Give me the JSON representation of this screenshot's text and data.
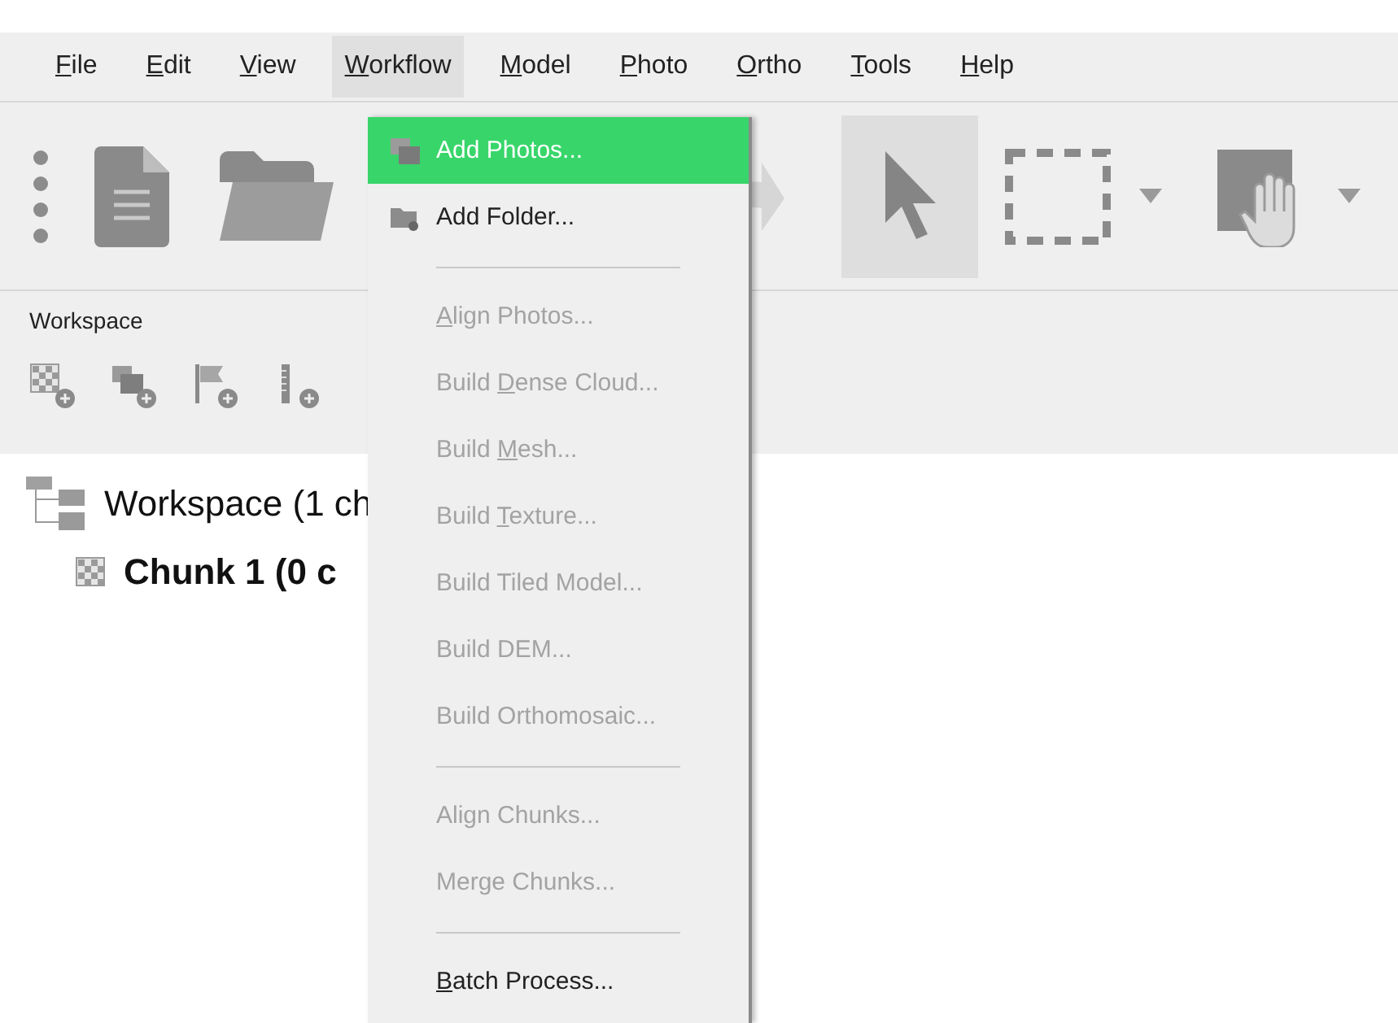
{
  "menubar": [
    {
      "key": "F",
      "post": "ile",
      "selected": false
    },
    {
      "key": "E",
      "post": "dit",
      "selected": false
    },
    {
      "key": "V",
      "post": "iew",
      "selected": false
    },
    {
      "key": "W",
      "post": "orkflow",
      "selected": true
    },
    {
      "key": "M",
      "post": "odel",
      "selected": false
    },
    {
      "key": "P",
      "post": "hoto",
      "selected": false
    },
    {
      "key": "O",
      "post": "rtho",
      "selected": false
    },
    {
      "key": "T",
      "post": "ools",
      "selected": false
    },
    {
      "key": "H",
      "post": "elp",
      "selected": false
    }
  ],
  "toolbar": [
    {
      "kind": "grip"
    },
    {
      "kind": "new"
    },
    {
      "kind": "open"
    },
    {
      "kind": "redo"
    },
    {
      "kind": "pointer",
      "selected": true
    },
    {
      "kind": "select-rect",
      "selected": false
    },
    {
      "kind": "caret"
    },
    {
      "kind": "hand",
      "selected": false
    },
    {
      "kind": "caret"
    }
  ],
  "workspace": {
    "title": "Workspace",
    "tools": [
      {
        "kind": "add-chunk"
      },
      {
        "kind": "add-group"
      },
      {
        "kind": "add-marker"
      },
      {
        "kind": "add-scalebar"
      }
    ],
    "tree": [
      {
        "label": "Workspace (1 ch",
        "kind": "workspace",
        "children": [
          {
            "label": "Chunk 1 (0 c",
            "kind": "chunk"
          }
        ]
      }
    ]
  },
  "dropdown": [
    {
      "kind": "photos-item",
      "pre": "Add Photos...",
      "selected": true,
      "disabled": false
    },
    {
      "kind": "folder-item",
      "pre": "Add Folder...",
      "selected": false,
      "disabled": false
    },
    {
      "kind": "separator"
    },
    {
      "kind": "item",
      "key": "A",
      "post": "lign Photos...",
      "selected": false,
      "disabled": true
    },
    {
      "kind": "item",
      "pre": "Build ",
      "key": "D",
      "post": "ense Cloud...",
      "selected": false,
      "disabled": true
    },
    {
      "kind": "item",
      "pre": "Build ",
      "key": "M",
      "post": "esh...",
      "selected": false,
      "disabled": true
    },
    {
      "kind": "item",
      "pre": "Build ",
      "key": "T",
      "post": "exture...",
      "selected": false,
      "disabled": true
    },
    {
      "kind": "item",
      "pre": "Build Tiled Model...",
      "selected": false,
      "disabled": true
    },
    {
      "kind": "item",
      "pre": "Build DEM...",
      "selected": false,
      "disabled": true
    },
    {
      "kind": "item",
      "pre": "Build Orthomosaic...",
      "selected": false,
      "disabled": true
    },
    {
      "kind": "separator"
    },
    {
      "kind": "item",
      "pre": "Align Chunks...",
      "selected": false,
      "disabled": true
    },
    {
      "kind": "item",
      "pre": "Merge Chunks...",
      "selected": false,
      "disabled": true
    },
    {
      "kind": "separator"
    },
    {
      "kind": "item",
      "key": "B",
      "post": "atch Process...",
      "selected": false,
      "disabled": false
    }
  ]
}
